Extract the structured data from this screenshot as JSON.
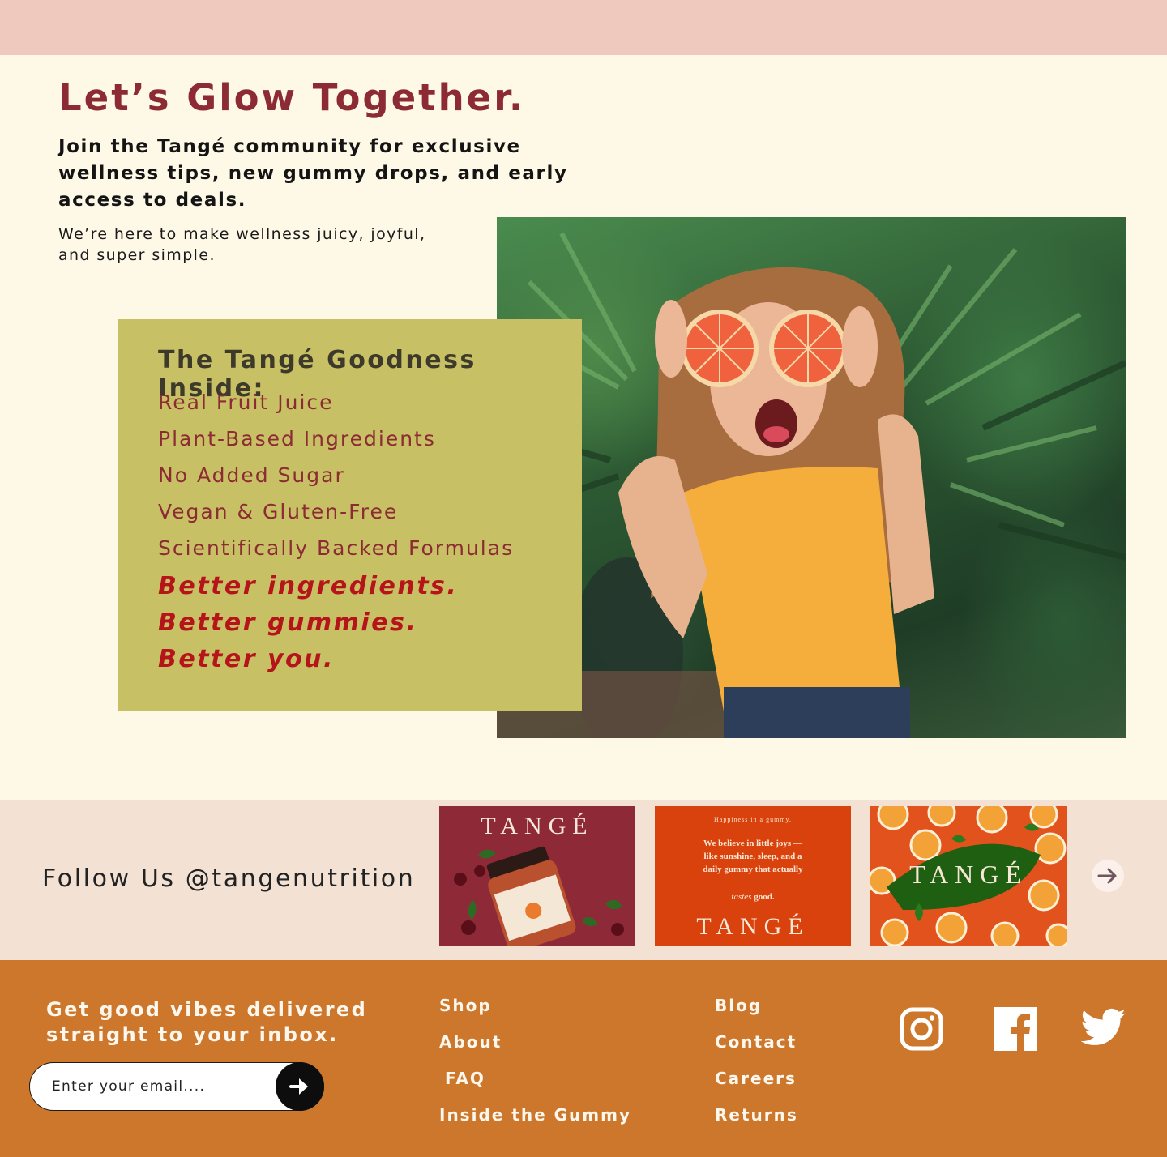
{
  "hero": {
    "title": "Let’s Glow Together.",
    "subtitle": "Join the Tangé community for exclusive wellness tips, new gummy drops, and early access to deals.",
    "body": "We’re here to make wellness juicy, joyful, and super simple.",
    "photo_icon": "woman-with-grapefruit-photo"
  },
  "goodness": {
    "title": "The Tangé Goodness Inside:",
    "items": [
      "Real Fruit Juice",
      "Plant-Based Ingredients",
      "No Added Sugar",
      "Vegan & Gluten-Free",
      "Scientifically Backed Formulas"
    ],
    "better": [
      "Better ingredients.",
      "Better gummies.",
      "Better you."
    ]
  },
  "follow": {
    "label": "Follow Us @tangenutrition",
    "tiles": [
      {
        "brand": "TANGÉ"
      },
      {
        "brand": "TANGÉ",
        "kicker": "Happiness in a gummy.",
        "quote": "We believe in little joys — like sunshine, sleep, and a daily gummy that actually",
        "quote_italic": "tastes",
        "quote_end": "good."
      },
      {
        "brand": "TANGÉ"
      }
    ],
    "next_icon": "arrow-right-icon"
  },
  "footer": {
    "cta": "Get good vibes delivered straight to your inbox.",
    "email_placeholder": "Enter your email....",
    "submit_icon": "arrow-right-icon",
    "col1": [
      "Shop",
      "About",
      "FAQ",
      "Inside the Gummy"
    ],
    "col2": [
      "Blog",
      "Contact",
      "Careers",
      "Returns"
    ],
    "social_icons": [
      "instagram-icon",
      "facebook-icon",
      "twitter-icon"
    ]
  },
  "colors": {
    "topbar": "#efc9bd",
    "hero_bg": "#fef8e6",
    "brand_maroon": "#8c2b34",
    "goodness_bg": "#c8c064",
    "better_red": "#b5141a",
    "follow_bg": "#f3e2d4",
    "footer_bg": "#cd772c"
  }
}
